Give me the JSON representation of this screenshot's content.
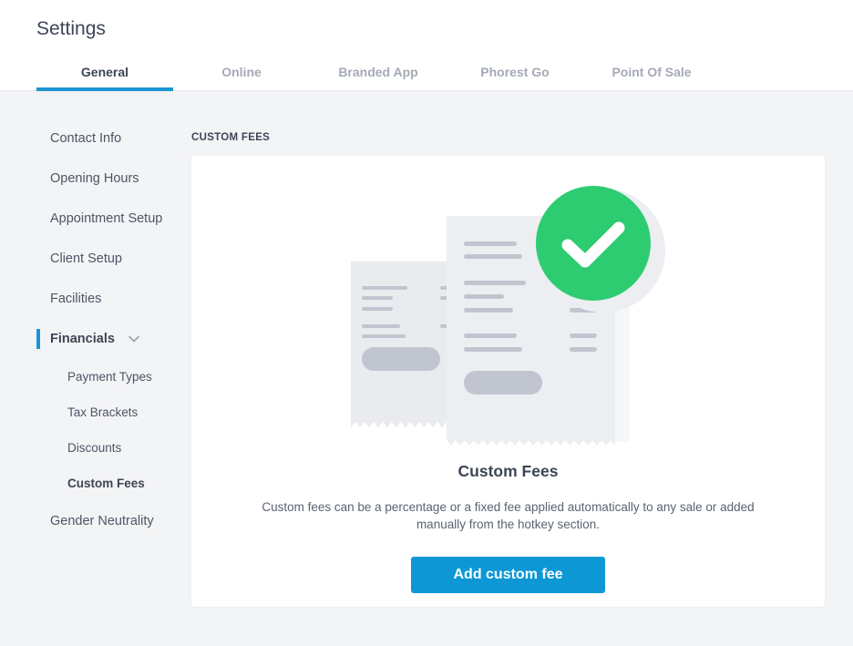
{
  "header": {
    "title": "Settings",
    "tabs": [
      {
        "label": "General",
        "active": true
      },
      {
        "label": "Online",
        "active": false
      },
      {
        "label": "Branded App",
        "active": false
      },
      {
        "label": "Phorest Go",
        "active": false
      },
      {
        "label": "Point Of Sale",
        "active": false
      }
    ]
  },
  "sidebar": {
    "items": [
      {
        "label": "Contact Info"
      },
      {
        "label": "Opening Hours"
      },
      {
        "label": "Appointment Setup"
      },
      {
        "label": "Client Setup"
      },
      {
        "label": "Facilities"
      },
      {
        "label": "Financials",
        "expanded": true,
        "icon": "chevron-down-icon"
      },
      {
        "label": "Gender Neutrality"
      }
    ],
    "financials_sub": [
      {
        "label": "Payment Types"
      },
      {
        "label": "Tax Brackets"
      },
      {
        "label": "Discounts"
      },
      {
        "label": "Custom Fees",
        "active": true
      }
    ]
  },
  "main": {
    "section_label": "CUSTOM FEES",
    "card": {
      "illustration": "receipts-with-checkmark",
      "title": "Custom Fees",
      "description": "Custom fees can be a percentage or a fixed fee applied automatically to any sale or added manually from the hotkey section.",
      "button_label": "Add custom fee"
    }
  },
  "colors": {
    "accent": "#1a95d3",
    "button": "#0d98d5",
    "success": "#2ecc71",
    "background": "#f3f4f6"
  }
}
